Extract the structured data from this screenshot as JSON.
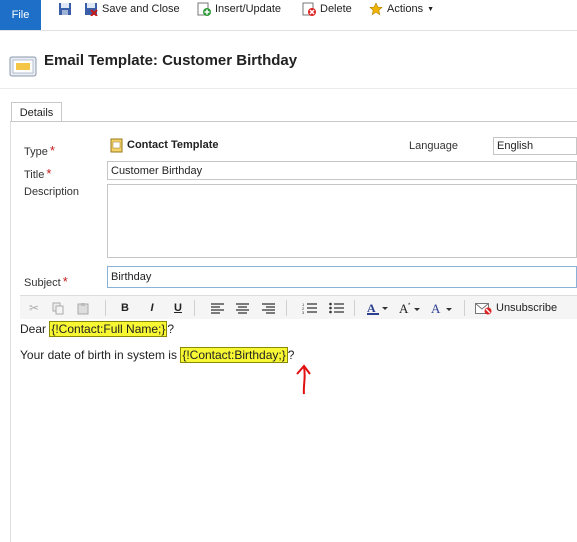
{
  "ribbon": {
    "file": "File",
    "save_close": "Save and Close",
    "insert_update": "Insert/Update",
    "delete": "Delete",
    "actions": "Actions"
  },
  "header": {
    "title": "Email Template: Customer Birthday"
  },
  "tabs": [
    {
      "label": "Details"
    }
  ],
  "form": {
    "type_label": "Type",
    "type_value": "Contact Template",
    "language_label": "Language",
    "language_value": "English",
    "title_label": "Title",
    "title_value": "Customer Birthday",
    "description_label": "Description",
    "description_value": "",
    "subject_label": "Subject",
    "subject_value": "Birthday",
    "required_mark": "*"
  },
  "editor_toolbar": {
    "bold": "B",
    "italic": "I",
    "underline": "U",
    "unsubscribe": "Unsubscribe"
  },
  "body": {
    "line1_prefix": "Dear ",
    "line1_token": "{!Contact:Full Name;}",
    "line1_suffix": "?",
    "line2_prefix": "Your date of birth in system is ",
    "line2_token": "{!Contact:Birthday;}",
    "line2_suffix": "?"
  },
  "colors": {
    "file_button": "#1e6fc8",
    "token_highlight": "#f7f734",
    "required": "#c41b1b",
    "annotation_arrow": "#e01010"
  }
}
